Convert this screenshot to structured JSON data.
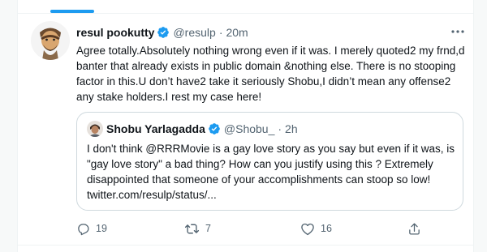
{
  "tweet": {
    "author_name": "resul pookutty",
    "author_handle": "@resulp",
    "separator": "·",
    "time": "20m",
    "text": "Agree totally.Absolutely nothing wrong even if it was. I merely quoted2 my frnd,d banter that already exists in public domain &nothing else. There is no stooping factor in this.U don’t have2 take it seriously Shobu,I didn’t mean any offense2 any stake holders.I rest my case here!",
    "icons": [
      "avatar",
      "verified-badge-icon",
      "more-options-icon"
    ]
  },
  "quoted": {
    "author_name": "Shobu Yarlagadda",
    "author_handle": "@Shobu_",
    "separator": "·",
    "time": "2h",
    "text": "I don't think @RRRMovie is a gay love story as you say but even if it was, is \"gay love story\" a bad thing? How can you justify using this ? Extremely disappointed that someone of your accomplishments can stoop so low! twitter.com/resulp/status/..."
  },
  "actions": {
    "reply_count": "19",
    "retweet_count": "7",
    "like_count": "16",
    "icons": [
      "reply-icon",
      "retweet-icon",
      "like-icon",
      "share-icon"
    ]
  },
  "colors": {
    "accent": "#1d9bf0",
    "secondary_text": "#536471",
    "border": "#cfd9de",
    "background": "#f7f9f9"
  }
}
